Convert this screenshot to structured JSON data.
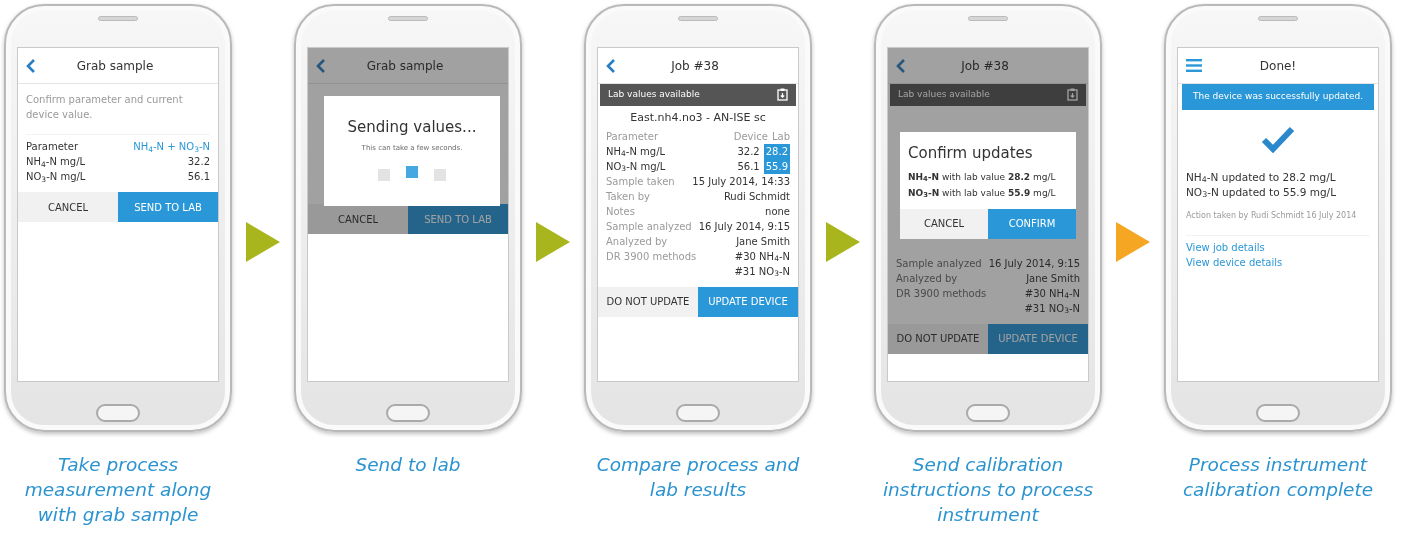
{
  "steps": [
    {
      "screen": {
        "nav": {
          "kind": "back"
        },
        "title": "Grab sample",
        "dimmed": false,
        "blocks": [
          {
            "kind": "note",
            "text": "Confirm parameter and current device value."
          },
          {
            "kind": "rule"
          },
          {
            "kind": "pair",
            "label": "Parameter",
            "value": "NH$_{4}$-N + NO$_{3}$-N",
            "muted": false,
            "accent": true
          },
          {
            "kind": "pair",
            "label": "NH$_{4}$-N mg/L",
            "value": "32.2",
            "muted": false,
            "accent": false
          },
          {
            "kind": "pair",
            "label": "NO$_{3}$-N mg/L",
            "value": "56.1",
            "muted": false,
            "accent": false
          }
        ],
        "buttons": [
          {
            "label": "CANCEL",
            "kind": "secondary"
          },
          {
            "label": "SEND TO LAB",
            "kind": "primary"
          }
        ]
      },
      "caption": "Take process measurement along with grab sample"
    },
    {
      "screen": {
        "nav": {
          "kind": "back"
        },
        "title": "Grab sample",
        "dimmed": true,
        "blocks": [
          {
            "kind": "dialog-space"
          }
        ],
        "buttons": [
          {
            "label": "CANCEL",
            "kind": "secondary"
          },
          {
            "label": "SEND TO LAB",
            "kind": "primary"
          }
        ],
        "dialog": {
          "kind": "progress",
          "title": "Sending values...",
          "text": "This can take a few seconds.",
          "dots": [
            {
              "selected": false
            },
            {
              "selected": true
            },
            {
              "selected": false
            }
          ]
        }
      },
      "caption": "Send to lab"
    },
    {
      "screen": {
        "nav": {
          "kind": "back"
        },
        "title": "Job #38",
        "dimmed": false,
        "banner": {
          "kind": "dark",
          "text": "Lab values available"
        },
        "blocks": [
          {
            "kind": "subtitle",
            "text": "East.nh4.no3 - AN-ISE sc"
          },
          {
            "kind": "triple",
            "label": "Parameter",
            "device": "Device",
            "lab": "Lab",
            "header": true,
            "highlighted": false
          },
          {
            "kind": "triple",
            "label": "NH$_{4}$-N mg/L",
            "device": "32.2",
            "lab": "28.2",
            "header": false,
            "highlighted": true
          },
          {
            "kind": "triple",
            "label": "NO$_{3}$-N mg/L",
            "device": "56.1",
            "lab": "55.9",
            "header": false,
            "highlighted": true
          },
          {
            "kind": "pair",
            "label": "Sample taken",
            "value": "15 July 2014, 14:33",
            "muted": true,
            "accent": false
          },
          {
            "kind": "pair",
            "label": "Taken by",
            "value": "Rudi Schmidt",
            "muted": true,
            "accent": false
          },
          {
            "kind": "pair",
            "label": "Notes",
            "value": "none",
            "muted": true,
            "accent": false
          },
          {
            "kind": "pair",
            "label": "Sample analyzed",
            "value": "16 July 2014, 9:15",
            "muted": true,
            "accent": false
          },
          {
            "kind": "pair",
            "label": "Analyzed by",
            "value": "Jane Smith",
            "muted": true,
            "accent": false
          },
          {
            "kind": "pair",
            "label": "DR 3900 methods",
            "values": [
              "#30 NH$_{4}$-N",
              "#31 NO$_{3}$-N"
            ],
            "muted": true,
            "accent": false
          }
        ],
        "buttons": [
          {
            "label": "DO NOT UPDATE",
            "kind": "secondary"
          },
          {
            "label": "UPDATE DEVICE",
            "kind": "primary"
          }
        ]
      },
      "caption": "Compare process and lab results"
    },
    {
      "screen": {
        "nav": {
          "kind": "back"
        },
        "title": "Job #38",
        "dimmed": true,
        "banner": {
          "kind": "dark",
          "text": "Lab values available"
        },
        "blocks": [
          {
            "kind": "dialog-space"
          },
          {
            "kind": "pair",
            "label": "Sample analyzed",
            "value": "16 July 2014, 9:15",
            "muted": true,
            "accent": false
          },
          {
            "kind": "pair",
            "label": "Analyzed by",
            "value": "Jane Smith",
            "muted": true,
            "accent": false
          },
          {
            "kind": "pair",
            "label": "DR 3900 methods",
            "values": [
              "#30 NH$_{4}$-N",
              "#31 NO$_{3}$-N"
            ],
            "muted": true,
            "accent": false
          }
        ],
        "buttons": [
          {
            "label": "DO NOT UPDATE",
            "kind": "secondary"
          },
          {
            "label": "UPDATE DEVICE",
            "kind": "primary"
          }
        ],
        "dialog": {
          "kind": "confirm",
          "title": "Confirm updates",
          "lines": [
            "**NH$_{4}$-N** with lab value **28.2** mg/L",
            "**NO$_{3}$-N** with lab value **55.9** mg/L"
          ],
          "buttons": [
            {
              "label": "CANCEL",
              "kind": "secondary"
            },
            {
              "label": "CONFIRM",
              "kind": "primary"
            }
          ]
        }
      },
      "caption": "Send calibration instructions to process instrument"
    },
    {
      "screen": {
        "nav": {
          "kind": "menu"
        },
        "title": "Done!",
        "dimmed": false,
        "banner": {
          "kind": "blue",
          "text": "The device was successfully updated."
        },
        "blocks": [
          {
            "kind": "check"
          },
          {
            "kind": "line",
            "text": "NH$_{4}$-N updated to 28.2 mg/L"
          },
          {
            "kind": "line",
            "text": "NO$_{3}$-N updated to 55.9 mg/L"
          },
          {
            "kind": "small",
            "text": "Action taken by Rudi Schmidt 16 July 2014"
          },
          {
            "kind": "rule"
          },
          {
            "kind": "link",
            "text": "View job details"
          },
          {
            "kind": "link",
            "text": "View device details"
          }
        ]
      },
      "caption": "Process instrument calibration complete"
    }
  ],
  "arrows": [
    {
      "color": "#a9b51c"
    },
    {
      "color": "#a9b51c"
    },
    {
      "color": "#a9b51c"
    },
    {
      "color": "#f5a623"
    }
  ]
}
